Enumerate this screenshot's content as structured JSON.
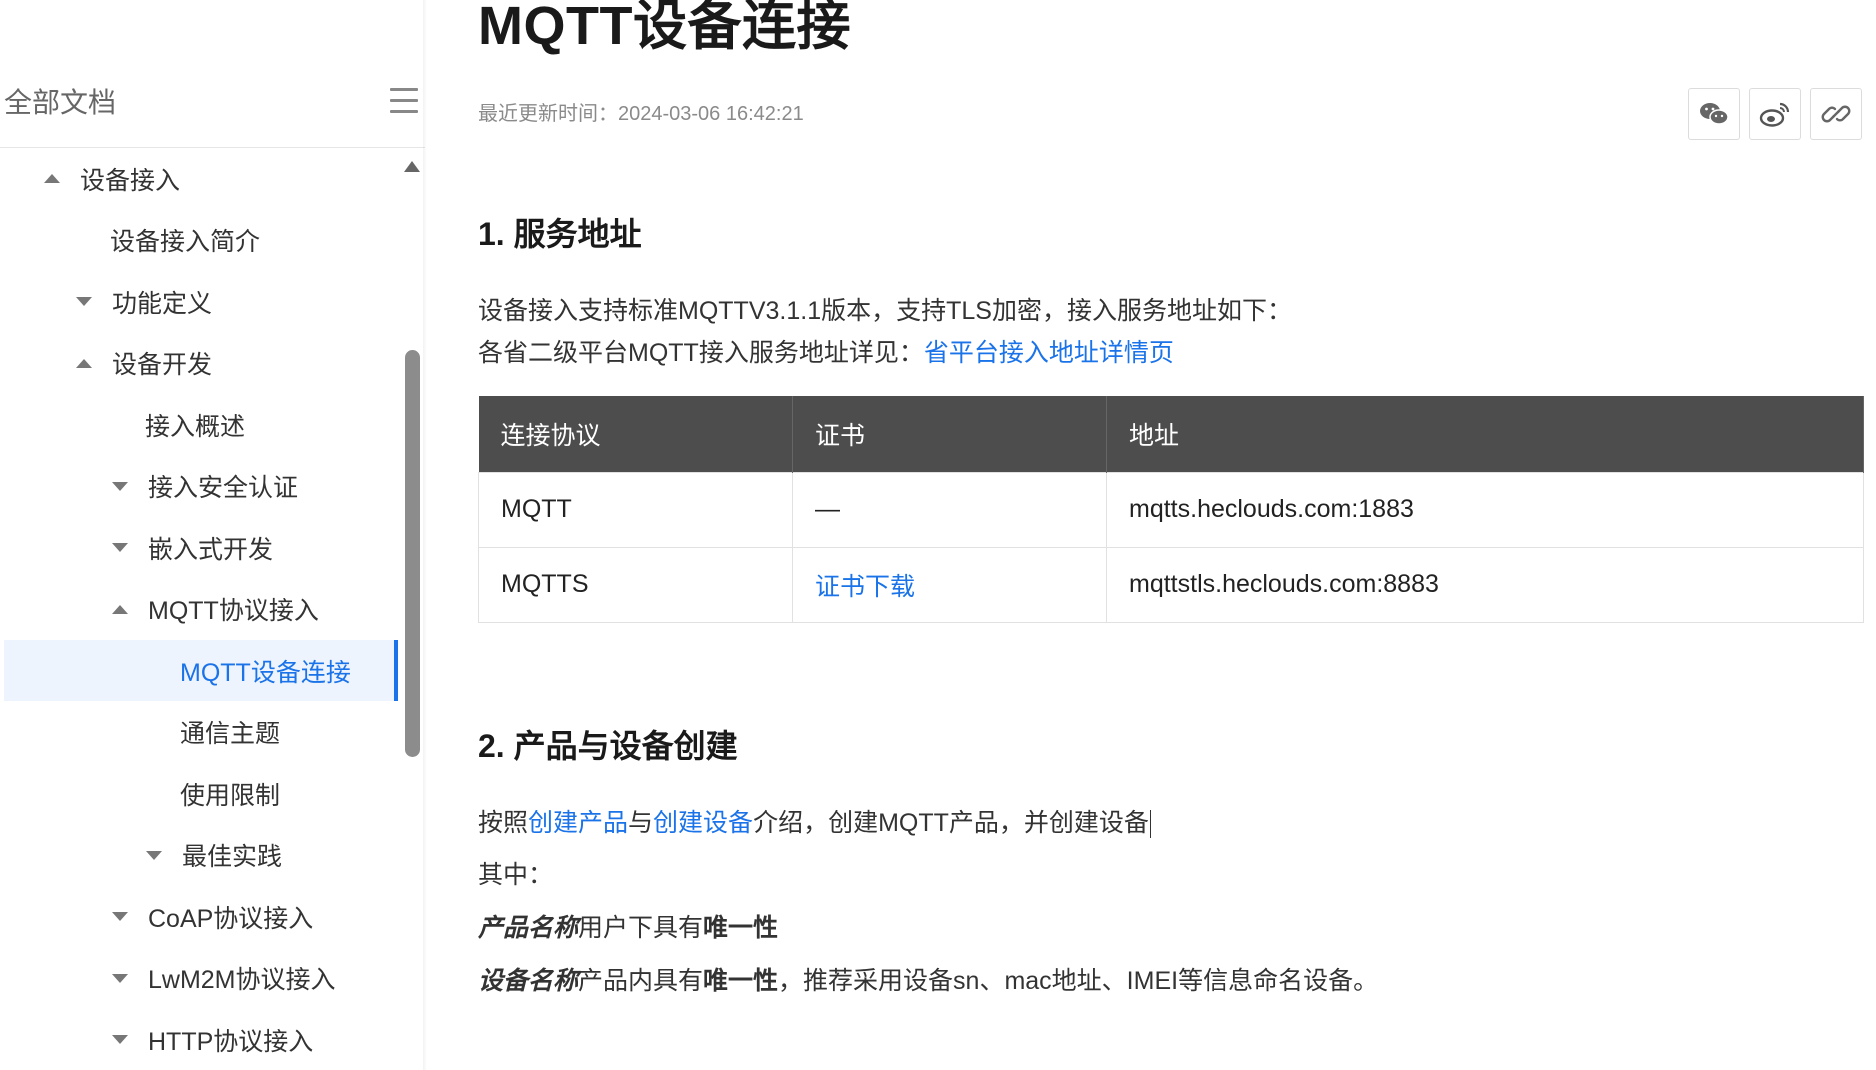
{
  "sidebar": {
    "title": "全部文档",
    "items": [
      {
        "label": "设备接入",
        "caret": "up"
      },
      {
        "label": "设备接入简介",
        "caret": "none"
      },
      {
        "label": "功能定义",
        "caret": "down"
      },
      {
        "label": "设备开发",
        "caret": "up"
      },
      {
        "label": "接入概述",
        "caret": "none"
      },
      {
        "label": "接入安全认证",
        "caret": "down"
      },
      {
        "label": "嵌入式开发",
        "caret": "down"
      },
      {
        "label": "MQTT协议接入",
        "caret": "up"
      },
      {
        "label": "MQTT设备连接",
        "caret": "none",
        "active": true
      },
      {
        "label": "通信主题",
        "caret": "none"
      },
      {
        "label": "使用限制",
        "caret": "none"
      },
      {
        "label": "最佳实践",
        "caret": "down"
      },
      {
        "label": "CoAP协议接入",
        "caret": "down"
      },
      {
        "label": "LwM2M协议接入",
        "caret": "down"
      },
      {
        "label": "HTTP协议接入",
        "caret": "down"
      }
    ]
  },
  "main": {
    "title": "MQTT设备连接",
    "updated": "最近更新时间：2024-03-06 16:42:21",
    "share_icons": [
      "wechat-icon",
      "weibo-icon",
      "link-icon"
    ],
    "section1": {
      "heading": "1. 服务地址",
      "line1": "设备接入支持标准MQTTV3.1.1版本，支持TLS加密，接入服务地址如下：",
      "line2_prefix": "各省二级平台MQTT接入服务地址详见：",
      "line2_link": "省平台接入地址详情页"
    },
    "table": {
      "headers": [
        "连接协议",
        "证书",
        "地址"
      ],
      "rows": [
        {
          "protocol": "MQTT",
          "cert": "—",
          "address": "mqtts.heclouds.com:1883"
        },
        {
          "protocol": "MQTTS",
          "cert": "证书下载",
          "address": "mqttstls.heclouds.com:8883"
        }
      ]
    },
    "section2": {
      "heading": "2. 产品与设备创建",
      "p1_a": "按照",
      "p1_link1": "创建产品",
      "p1_b": "与",
      "p1_link2": "创建设备",
      "p1_c": "介绍，创建MQTT产品，并创建设备",
      "p2": "其中：",
      "p3_bi": "产品名称",
      "p3_text": "用户下具有",
      "p3_bold": "唯一性",
      "p4_bi": "设备名称",
      "p4_text": "产品内具有",
      "p4_bold": "唯一性",
      "p4_tail": "，推荐采用设备sn、mac地址、IMEI等信息命名设备。"
    }
  },
  "colors": {
    "accent": "#1a73e8",
    "table_header": "#4d4d4d"
  }
}
